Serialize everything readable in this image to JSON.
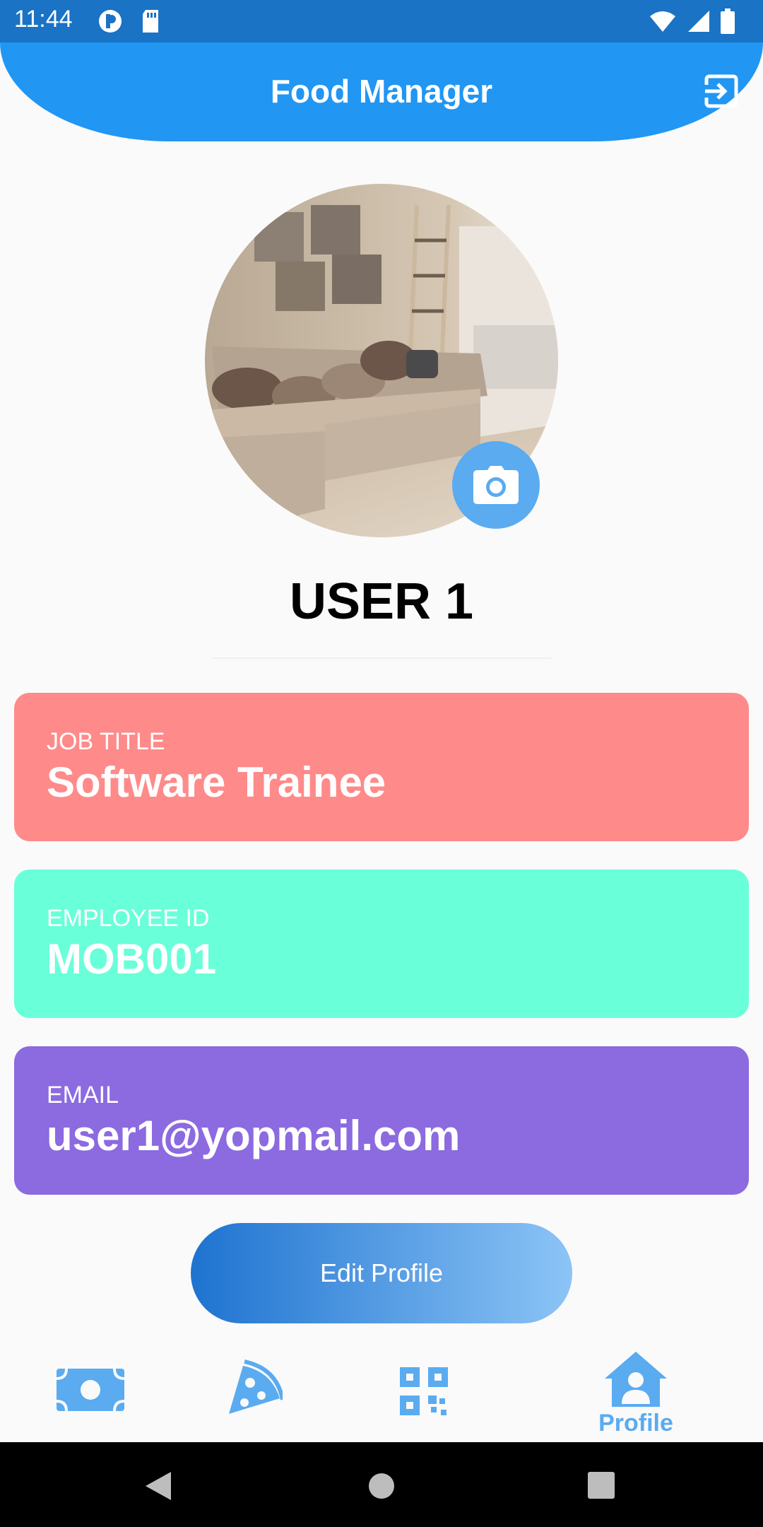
{
  "status_bar": {
    "time": "11:44"
  },
  "app_bar": {
    "title": "Food Manager",
    "action_icon": "logout-icon"
  },
  "profile": {
    "name": "USER 1",
    "camera_icon": "camera-icon"
  },
  "cards": {
    "job": {
      "label": "JOB TITLE",
      "value": "Software Trainee",
      "color": "#ff8a8a"
    },
    "employee": {
      "label": "EMPLOYEE ID",
      "value": "MOB001",
      "color": "#69ffd9"
    },
    "email": {
      "label": "EMAIL",
      "value": "user1@yopmail.com",
      "color": "#8c6ae0"
    }
  },
  "edit_button": {
    "label": "Edit Profile"
  },
  "bottom_nav": {
    "items": [
      {
        "icon": "money-icon"
      },
      {
        "icon": "pizza-icon"
      },
      {
        "icon": "qr-code-icon"
      },
      {
        "icon": "profile-home-icon",
        "label": "Profile"
      }
    ],
    "accent": "#5aabf0"
  },
  "colors": {
    "primary": "#2196f3",
    "status_bar": "#1a73c4"
  }
}
